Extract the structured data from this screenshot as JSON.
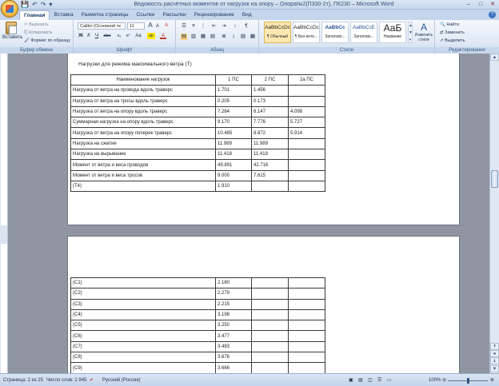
{
  "window": {
    "title": "Ведомость расчётных моментов от нагрузок на опору – Опора№2(П330-2т), ПК230 – Microsoft Word",
    "controls": [
      "–",
      "□",
      "✕"
    ]
  },
  "quick_access": [
    "💾",
    "↶",
    "↷",
    "▾"
  ],
  "tabs": [
    "Главная",
    "Вставка",
    "Разметка страницы",
    "Ссылки",
    "Рассылки",
    "Рецензирование",
    "Вид"
  ],
  "ribbon": {
    "clipboard": {
      "paste": "Вставить",
      "cut": "Вырезать",
      "copy": "Копировать",
      "format_painter": "Формат по образцу",
      "label": "Буфер обмена"
    },
    "font": {
      "name": "Calibri (Основной те",
      "size": "11",
      "label": "Шрифт",
      "bold": "Ж",
      "italic": "К",
      "underline": "Ч",
      "strike": "abe",
      "sub": "x₂",
      "sup": "x²",
      "case": "Aa",
      "grow": "A",
      "shrink": "A",
      "clear": "A",
      "highlight": "ab",
      "color": "A"
    },
    "paragraph": {
      "label": "Абзац",
      "buttons": [
        "☰",
        "≡",
        "⋮",
        "⇤",
        "⇥",
        "↕",
        "¶",
        "▤",
        "▥",
        "▦",
        "▧",
        "≣",
        "↨",
        "▨",
        "▩"
      ]
    },
    "styles": {
      "label": "Стили",
      "items": [
        {
          "sample": "AaBbCcDc",
          "name": "¶ Обычный"
        },
        {
          "sample": "AaBbCcDc",
          "name": "¶ Без инте..."
        },
        {
          "sample": "AaBbCc",
          "name": "Заголово..."
        },
        {
          "sample": "AaBbCcE",
          "name": "Заголово..."
        },
        {
          "sample": "АаБ",
          "name": "Название"
        }
      ],
      "change": "Изменить стили"
    },
    "editing": {
      "label": "Редактирование",
      "find": "Найти",
      "replace": "Заменить",
      "select": "Выделить"
    }
  },
  "document": {
    "heading": "Нагрузки для режима максимального ветра (Т)",
    "table1": {
      "headers": [
        "Наименование нагрузок",
        "1 ПС",
        "2 ПС",
        "2а ПС"
      ],
      "rows": [
        [
          "Нагрузка от ветра на провода вдоль траверс",
          "1.701",
          "1.456",
          ""
        ],
        [
          "Нагрузка от ветра на тросы вдоль траверс",
          "0.205",
          "0.173",
          ""
        ],
        [
          "Нагрузка от ветра на опору вдоль траверс",
          "7.264",
          "6.147",
          "4.098"
        ],
        [
          "Суммарная нагрузка на опору вдоль траверс",
          "9.170",
          "7.776",
          "5.727"
        ],
        [
          "Нагрузка от ветра на опору поперек траверс",
          "10.485",
          "8.872",
          "5.914"
        ],
        [
          "Нагрузка на сжатие",
          "11.989",
          "11.989",
          ""
        ],
        [
          "Нагрузка на вырывание",
          "11.418",
          "11.418",
          ""
        ],
        [
          "Момент от ветра и веса проводов",
          "49.891",
          "42.716",
          ""
        ],
        [
          "Момент от ветра и веса тросов",
          "9.000",
          "7.615",
          ""
        ],
        [
          "(T4)",
          "1.910",
          "",
          ""
        ]
      ]
    },
    "table2": {
      "rows": [
        [
          "(C1)",
          "2.180",
          "",
          ""
        ],
        [
          "(C2)",
          "2.279",
          "",
          ""
        ],
        [
          "(C3)",
          "2.215",
          "",
          ""
        ],
        [
          "(C4)",
          "3.198",
          "",
          ""
        ],
        [
          "(C5)",
          "3.250",
          "",
          ""
        ],
        [
          "(C6)",
          "3.477",
          "",
          ""
        ],
        [
          "(C7)",
          "3.483",
          "",
          ""
        ],
        [
          "(C8)",
          "3.676",
          "",
          ""
        ],
        [
          "(C9)",
          "3.666",
          "",
          ""
        ]
      ]
    }
  },
  "statusbar": {
    "page": "Страница: 2 из 25",
    "words": "Число слов: 1 945",
    "language": "Русский (Россия)",
    "zoom": "100%"
  }
}
